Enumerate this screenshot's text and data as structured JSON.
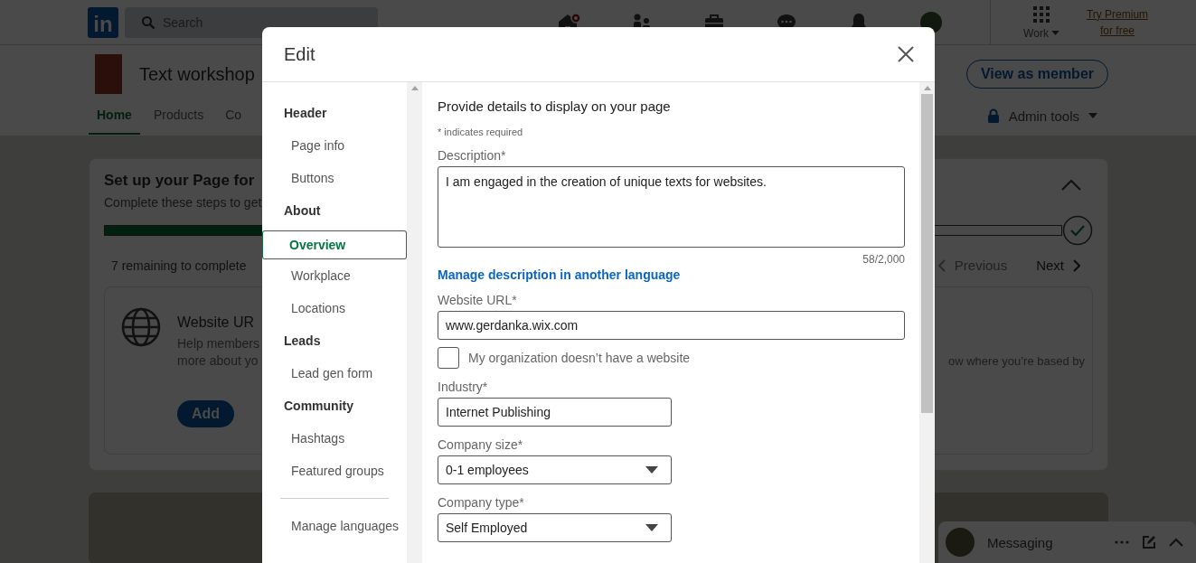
{
  "topbar": {
    "logo": "in",
    "search": {
      "placeholder": "Search"
    },
    "work": "Work",
    "premium": "Try Premium for free",
    "home_notification": true
  },
  "page_header": {
    "title": "Text workshop",
    "view_button": "View as member",
    "tabs": [
      {
        "label": "Home",
        "selected": true
      },
      {
        "label": "Products",
        "selected": false
      },
      {
        "label": "Co",
        "selected": false
      }
    ],
    "admin": "Admin tools"
  },
  "setup_card": {
    "title": "Set up your Page for",
    "subtitle": "Complete these steps to get",
    "progress": {
      "level": 0.2
    },
    "remaining": "7 remaining to complete",
    "previous": "Previous",
    "next": "Next",
    "steps": [
      {
        "title": "Website UR",
        "text": "Help members",
        "text2": "more about yo",
        "button": "Add"
      },
      {
        "text": "ow where you’re based by"
      }
    ]
  },
  "messaging": {
    "label": "Messaging"
  },
  "modal": {
    "title": "Edit",
    "nav": [
      {
        "label": "Header",
        "kind": "section",
        "selected": false
      },
      {
        "label": "Page info",
        "kind": "item",
        "selected": false
      },
      {
        "label": "Buttons",
        "kind": "item",
        "selected": false
      },
      {
        "label": "About",
        "kind": "section",
        "selected": false
      },
      {
        "label": "Overview",
        "kind": "item",
        "selected": true
      },
      {
        "label": "Workplace",
        "kind": "item",
        "selected": false
      },
      {
        "label": "Locations",
        "kind": "item",
        "selected": false
      },
      {
        "label": "Leads",
        "kind": "section",
        "selected": false
      },
      {
        "label": "Lead gen form",
        "kind": "item",
        "selected": false
      },
      {
        "label": "Community",
        "kind": "section",
        "selected": false
      },
      {
        "label": "Hashtags",
        "kind": "item",
        "selected": false
      },
      {
        "label": "Featured groups",
        "kind": "item",
        "selected": false
      },
      {
        "label": "Manage languages",
        "kind": "footer",
        "selected": false
      }
    ],
    "heading": "Provide details to display on your page",
    "required_note": "* indicates required",
    "description": {
      "label": "Description*",
      "value": "I am engaged in the creation of unique texts for websites.",
      "counter": "58/2,000"
    },
    "language_link": "Manage description in another language",
    "website": {
      "label": "Website URL*",
      "value": "www.gerdanka.wix.com"
    },
    "no_website": {
      "label": "My organization doesn’t have a website",
      "checked": false
    },
    "industry": {
      "label": "Industry*",
      "value": "Internet Publishing"
    },
    "company_size": {
      "label": "Company size*",
      "value": "0-1 employees"
    },
    "company_type": {
      "label": "Company type*",
      "value": "Self Employed"
    }
  }
}
